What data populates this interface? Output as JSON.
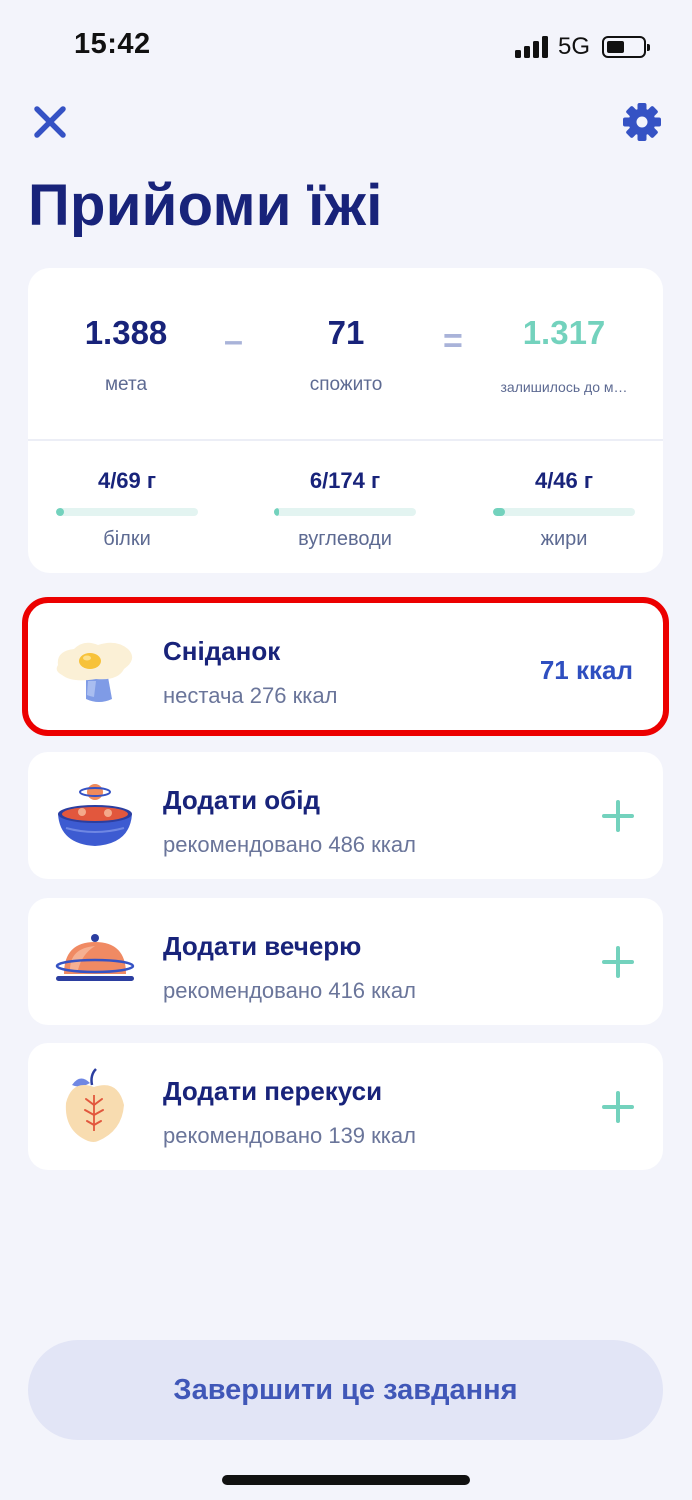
{
  "status_bar": {
    "time": "15:42",
    "network": "5G"
  },
  "header": {
    "title": "Прийоми їжі",
    "close_icon": "close-icon",
    "settings_icon": "gear-icon"
  },
  "summary": {
    "goal": {
      "value": "1.388",
      "label": "мета"
    },
    "minus": "–",
    "consumed": {
      "value": "71",
      "label": "спожито"
    },
    "equals": "=",
    "remaining": {
      "value": "1.317",
      "label": "залишилось до м…"
    },
    "macros": [
      {
        "value": "4/69 г",
        "label": "білки",
        "progress": 0.058
      },
      {
        "value": "6/174 г",
        "label": "вуглеводи",
        "progress": 0.034
      },
      {
        "value": "4/46 г",
        "label": "жири",
        "progress": 0.087
      }
    ]
  },
  "meals": [
    {
      "title": "Сніданок",
      "subtitle": "нестача 276 ккал",
      "kcal": "71 ккал",
      "icon": "fried-egg-icon"
    },
    {
      "title": "Додати обід",
      "subtitle": "рекомендовано 486 ккал",
      "icon": "bowl-icon",
      "action_icon": "plus-icon"
    },
    {
      "title": "Додати вечерю",
      "subtitle": "рекомендовано 416 ккал",
      "icon": "cloche-icon",
      "action_icon": "plus-icon"
    },
    {
      "title": "Додати перекуси",
      "subtitle": "рекомендовано 139 ккал",
      "icon": "apple-icon",
      "action_icon": "plus-icon"
    }
  ],
  "footer": {
    "finish_label": "Завершити це завдання"
  },
  "colors": {
    "title": "#18237a",
    "accent": "#2f4fc0",
    "teal": "#73d2bd",
    "background": "#f3f4fb",
    "highlight": "#ec0000"
  }
}
